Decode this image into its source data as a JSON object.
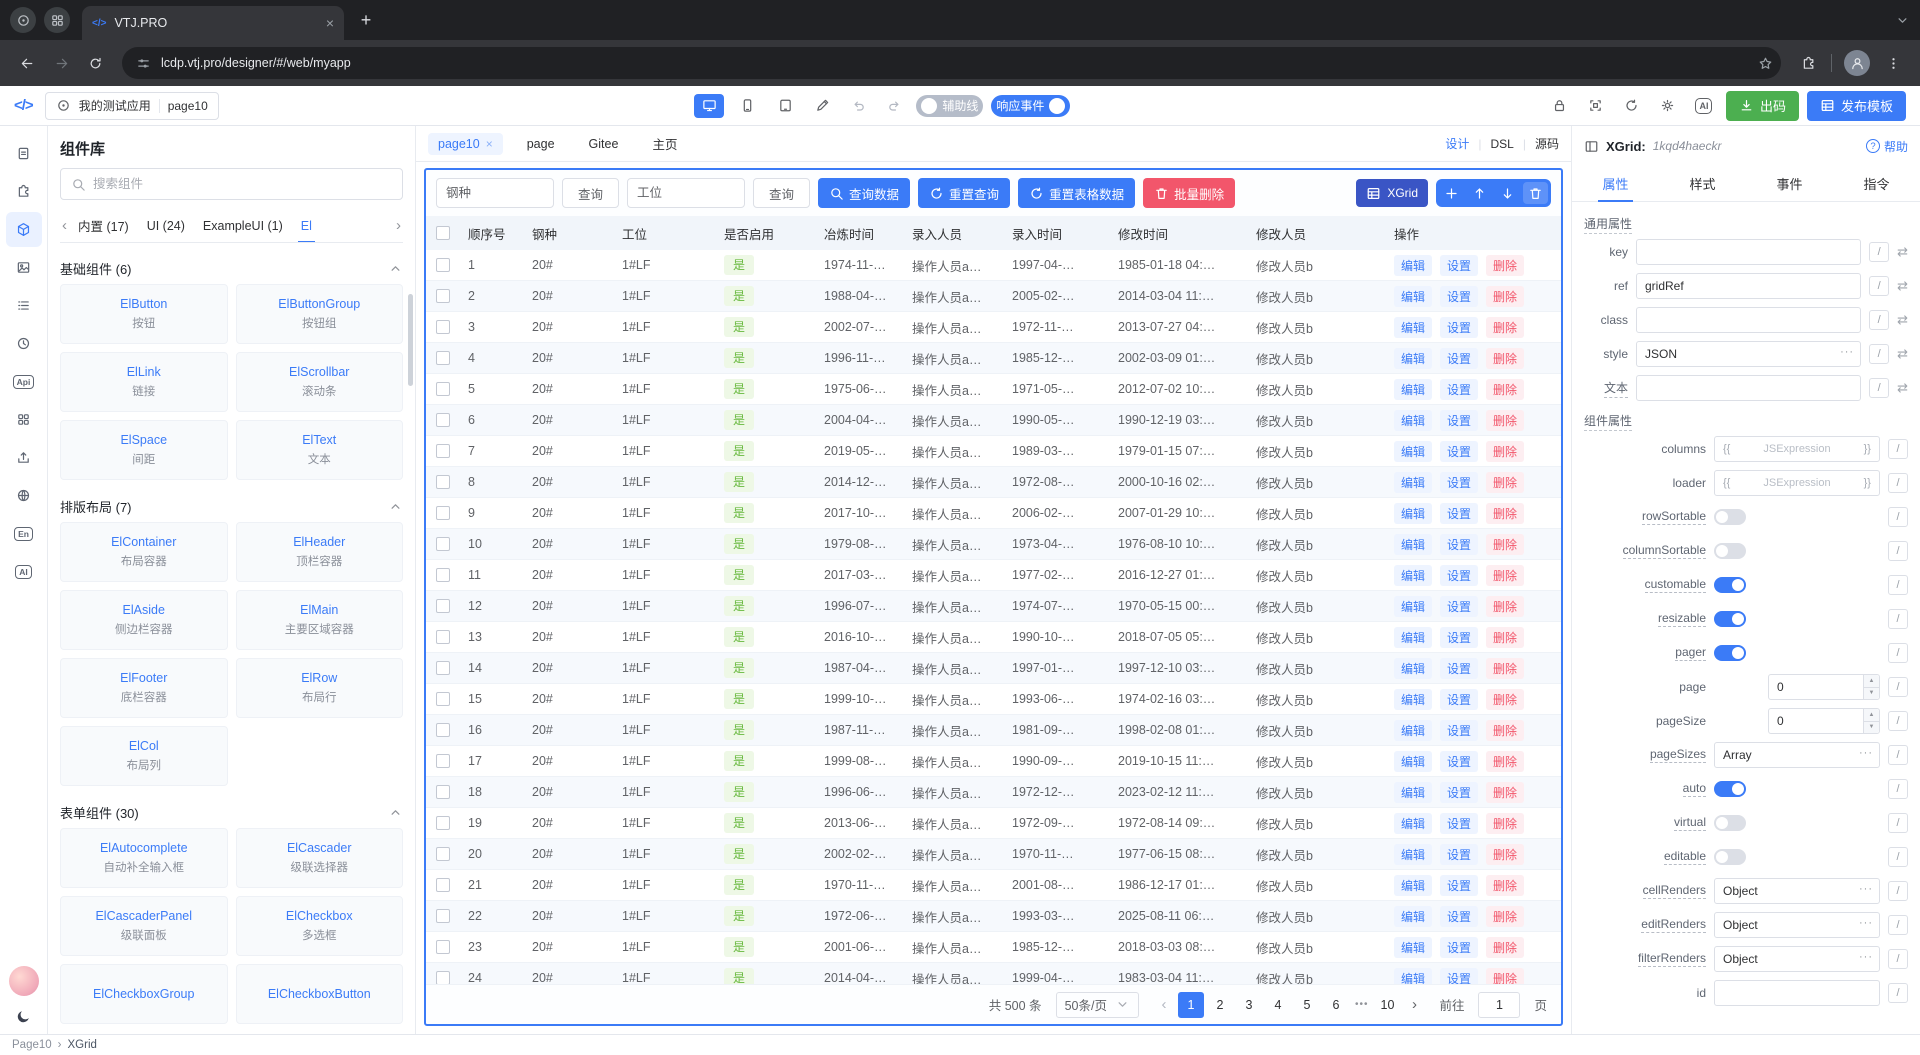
{
  "colors": {
    "accent": "#3b7bf7",
    "green": "#4caf50",
    "red": "#f2566b",
    "navy": "#3a55c5",
    "badge_green": "#67b83d"
  },
  "browser": {
    "tab_title": "VTJ.PRO",
    "url": "lcdp.vtj.pro/designer/#/web/myapp"
  },
  "header": {
    "app_name": "我的测试应用",
    "page_name": "page10",
    "guides_label": "辅助线",
    "events_label": "响应事件",
    "codegen_label": "出码",
    "publish_label": "发布模板"
  },
  "rail": {
    "items": [
      {
        "id": "doc"
      },
      {
        "id": "plugin"
      },
      {
        "id": "cube",
        "active": true
      },
      {
        "id": "frame"
      },
      {
        "id": "outline"
      },
      {
        "id": "history"
      },
      {
        "id": "api",
        "text": "Api"
      },
      {
        "id": "apps"
      },
      {
        "id": "publish"
      },
      {
        "id": "globe"
      },
      {
        "id": "lang",
        "text": "En"
      },
      {
        "id": "ai",
        "text": "AI"
      }
    ]
  },
  "library": {
    "title": "组件库",
    "search_placeholder": "搜索组件",
    "tabs": [
      {
        "label": "内置 (17)"
      },
      {
        "label": "UI (24)"
      },
      {
        "label": "ExampleUI (1)"
      },
      {
        "label": "El",
        "active": true
      }
    ],
    "sections": [
      {
        "title": "基础组件 (6)",
        "items": [
          [
            "ElButton",
            "按钮"
          ],
          [
            "ElButtonGroup",
            "按钮组"
          ],
          [
            "ElLink",
            "链接"
          ],
          [
            "ElScrollbar",
            "滚动条"
          ],
          [
            "ElSpace",
            "间距"
          ],
          [
            "ElText",
            "文本"
          ]
        ]
      },
      {
        "title": "排版布局 (7)",
        "items": [
          [
            "ElContainer",
            "布局容器"
          ],
          [
            "ElHeader",
            "顶栏容器"
          ],
          [
            "ElAside",
            "侧边栏容器"
          ],
          [
            "ElMain",
            "主要区域容器"
          ],
          [
            "ElFooter",
            "底栏容器"
          ],
          [
            "ElRow",
            "布局行"
          ],
          [
            "ElCol",
            "布局列"
          ]
        ]
      },
      {
        "title": "表单组件 (30)",
        "items": [
          [
            "ElAutocomplete",
            "自动补全输入框"
          ],
          [
            "ElCascader",
            "级联选择器"
          ],
          [
            "ElCascaderPanel",
            "级联面板"
          ],
          [
            "ElCheckbox",
            "多选框"
          ],
          [
            "ElCheckboxGroup",
            ""
          ],
          [
            "ElCheckboxButton",
            ""
          ]
        ]
      }
    ]
  },
  "canvas": {
    "tabs": [
      {
        "label": "page10",
        "active": true,
        "closable": true
      },
      {
        "label": "page"
      },
      {
        "label": "Gitee"
      },
      {
        "label": "主页"
      }
    ],
    "modes": [
      {
        "label": "设计",
        "active": true
      },
      {
        "label": "DSL"
      },
      {
        "label": "源码"
      }
    ],
    "toolbar": {
      "steel_placeholder": "钢种",
      "station_placeholder": "工位",
      "search_btn": "查询",
      "query_data": "查询数据",
      "reset_query": "重置查询",
      "reset_table": "重置表格数据",
      "batch_delete": "批量删除",
      "widget_chip": "XGrid"
    },
    "table": {
      "columns": [
        "顺序号",
        "钢种",
        "工位",
        "是否启用",
        "冶炼时间",
        "录入人员",
        "录入时间",
        "修改时间",
        "修改人员",
        "操作"
      ],
      "actions": [
        "编辑",
        "设置",
        "删除"
      ],
      "rows": [
        {
          "n": "1",
          "steel": "20#",
          "station": "1#LF",
          "enabled": "是",
          "smelt": "1974-11-…",
          "entered_by": "操作人员a…",
          "entered_at": "1997-04-…",
          "modified_at": "1985-01-18 04:…",
          "modified_by": "修改人员b"
        },
        {
          "n": "2",
          "steel": "20#",
          "station": "1#LF",
          "enabled": "是",
          "smelt": "1988-04-…",
          "entered_by": "操作人员a…",
          "entered_at": "2005-02-…",
          "modified_at": "2014-03-04 11:…",
          "modified_by": "修改人员b"
        },
        {
          "n": "3",
          "steel": "20#",
          "station": "1#LF",
          "enabled": "是",
          "smelt": "2002-07-…",
          "entered_by": "操作人员a…",
          "entered_at": "1972-11-…",
          "modified_at": "2013-07-27 04:…",
          "modified_by": "修改人员b"
        },
        {
          "n": "4",
          "steel": "20#",
          "station": "1#LF",
          "enabled": "是",
          "smelt": "1996-11-…",
          "entered_by": "操作人员a…",
          "entered_at": "1985-12-…",
          "modified_at": "2002-03-09 01:…",
          "modified_by": "修改人员b"
        },
        {
          "n": "5",
          "steel": "20#",
          "station": "1#LF",
          "enabled": "是",
          "smelt": "1975-06-…",
          "entered_by": "操作人员a…",
          "entered_at": "1971-05-…",
          "modified_at": "2012-07-02 10:…",
          "modified_by": "修改人员b"
        },
        {
          "n": "6",
          "steel": "20#",
          "station": "1#LF",
          "enabled": "是",
          "smelt": "2004-04-…",
          "entered_by": "操作人员a…",
          "entered_at": "1990-05-…",
          "modified_at": "1990-12-19 03:…",
          "modified_by": "修改人员b"
        },
        {
          "n": "7",
          "steel": "20#",
          "station": "1#LF",
          "enabled": "是",
          "smelt": "2019-05-…",
          "entered_by": "操作人员a…",
          "entered_at": "1989-03-…",
          "modified_at": "1979-01-15 07:…",
          "modified_by": "修改人员b"
        },
        {
          "n": "8",
          "steel": "20#",
          "station": "1#LF",
          "enabled": "是",
          "smelt": "2014-12-…",
          "entered_by": "操作人员a…",
          "entered_at": "1972-08-…",
          "modified_at": "2000-10-16 02:…",
          "modified_by": "修改人员b"
        },
        {
          "n": "9",
          "steel": "20#",
          "station": "1#LF",
          "enabled": "是",
          "smelt": "2017-10-…",
          "entered_by": "操作人员a…",
          "entered_at": "2006-02-…",
          "modified_at": "2007-01-29 10:…",
          "modified_by": "修改人员b"
        },
        {
          "n": "10",
          "steel": "20#",
          "station": "1#LF",
          "enabled": "是",
          "smelt": "1979-08-…",
          "entered_by": "操作人员a…",
          "entered_at": "1973-04-…",
          "modified_at": "1976-08-10 10:…",
          "modified_by": "修改人员b"
        },
        {
          "n": "11",
          "steel": "20#",
          "station": "1#LF",
          "enabled": "是",
          "smelt": "2017-03-…",
          "entered_by": "操作人员a…",
          "entered_at": "1977-02-…",
          "modified_at": "2016-12-27 01:…",
          "modified_by": "修改人员b"
        },
        {
          "n": "12",
          "steel": "20#",
          "station": "1#LF",
          "enabled": "是",
          "smelt": "1996-07-…",
          "entered_by": "操作人员a…",
          "entered_at": "1974-07-…",
          "modified_at": "1970-05-15 00:…",
          "modified_by": "修改人员b"
        },
        {
          "n": "13",
          "steel": "20#",
          "station": "1#LF",
          "enabled": "是",
          "smelt": "2016-10-…",
          "entered_by": "操作人员a…",
          "entered_at": "1990-10-…",
          "modified_at": "2018-07-05 05:…",
          "modified_by": "修改人员b"
        },
        {
          "n": "14",
          "steel": "20#",
          "station": "1#LF",
          "enabled": "是",
          "smelt": "1987-04-…",
          "entered_by": "操作人员a…",
          "entered_at": "1997-01-…",
          "modified_at": "1997-12-10 03:…",
          "modified_by": "修改人员b"
        },
        {
          "n": "15",
          "steel": "20#",
          "station": "1#LF",
          "enabled": "是",
          "smelt": "1999-10-…",
          "entered_by": "操作人员a…",
          "entered_at": "1993-06-…",
          "modified_at": "1974-02-16 03:…",
          "modified_by": "修改人员b"
        },
        {
          "n": "16",
          "steel": "20#",
          "station": "1#LF",
          "enabled": "是",
          "smelt": "1987-11-…",
          "entered_by": "操作人员a…",
          "entered_at": "1981-09-…",
          "modified_at": "1998-02-08 01:…",
          "modified_by": "修改人员b"
        },
        {
          "n": "17",
          "steel": "20#",
          "station": "1#LF",
          "enabled": "是",
          "smelt": "1999-08-…",
          "entered_by": "操作人员a…",
          "entered_at": "1990-09-…",
          "modified_at": "2019-10-15 11:…",
          "modified_by": "修改人员b"
        },
        {
          "n": "18",
          "steel": "20#",
          "station": "1#LF",
          "enabled": "是",
          "smelt": "1996-06-…",
          "entered_by": "操作人员a…",
          "entered_at": "1972-12-…",
          "modified_at": "2023-02-12 11:…",
          "modified_by": "修改人员b"
        },
        {
          "n": "19",
          "steel": "20#",
          "station": "1#LF",
          "enabled": "是",
          "smelt": "2013-06-…",
          "entered_by": "操作人员a…",
          "entered_at": "1972-09-…",
          "modified_at": "1972-08-14 09:…",
          "modified_by": "修改人员b"
        },
        {
          "n": "20",
          "steel": "20#",
          "station": "1#LF",
          "enabled": "是",
          "smelt": "2002-02-…",
          "entered_by": "操作人员a…",
          "entered_at": "1970-11-…",
          "modified_at": "1977-06-15 08:…",
          "modified_by": "修改人员b"
        },
        {
          "n": "21",
          "steel": "20#",
          "station": "1#LF",
          "enabled": "是",
          "smelt": "1970-11-…",
          "entered_by": "操作人员a…",
          "entered_at": "2001-08-…",
          "modified_at": "1986-12-17 01:…",
          "modified_by": "修改人员b"
        },
        {
          "n": "22",
          "steel": "20#",
          "station": "1#LF",
          "enabled": "是",
          "smelt": "1972-06-…",
          "entered_by": "操作人员a…",
          "entered_at": "1993-03-…",
          "modified_at": "2025-08-11 06:…",
          "modified_by": "修改人员b"
        },
        {
          "n": "23",
          "steel": "20#",
          "station": "1#LF",
          "enabled": "是",
          "smelt": "2001-06-…",
          "entered_by": "操作人员a…",
          "entered_at": "1985-12-…",
          "modified_at": "2018-03-03 08:…",
          "modified_by": "修改人员b"
        },
        {
          "n": "24",
          "steel": "20#",
          "station": "1#LF",
          "enabled": "是",
          "smelt": "2014-04-…",
          "entered_by": "操作人员a…",
          "entered_at": "1999-04-…",
          "modified_at": "1983-03-04 11:…",
          "modified_by": "修改人员b"
        }
      ]
    },
    "pager": {
      "total": "共 500 条",
      "page_size": "50条/页",
      "pages": [
        "1",
        "2",
        "3",
        "4",
        "5",
        "6"
      ],
      "active_page": "1",
      "ellipsis": "•••",
      "last": "10",
      "goto_label": "前往",
      "goto_value": "1",
      "goto_suffix": "页"
    }
  },
  "inspector": {
    "widget": "XGrid:",
    "instance": "1kqd4haeckr",
    "help": "帮助",
    "expr_open": "{{",
    "expr_close": "}}",
    "tabs": [
      {
        "label": "属性",
        "active": true
      },
      {
        "label": "样式"
      },
      {
        "label": "事件"
      },
      {
        "label": "指令"
      }
    ],
    "sections": [
      {
        "title": "通用属性",
        "label_width": 44,
        "swap": true,
        "fields": [
          {
            "label": "key",
            "type": "input",
            "value": ""
          },
          {
            "label": "ref",
            "type": "input",
            "value": "gridRef"
          },
          {
            "label": "class",
            "type": "input",
            "value": ""
          },
          {
            "label": "style",
            "type": "ellipsis",
            "value": "JSON"
          },
          {
            "label": "文本",
            "type": "input",
            "value": "",
            "underline": true
          }
        ]
      },
      {
        "title": "组件属性",
        "label_width": 122,
        "swap": false,
        "fields": [
          {
            "label": "columns",
            "type": "expr",
            "value": "JSExpression"
          },
          {
            "label": "loader",
            "type": "expr",
            "value": "JSExpression"
          },
          {
            "label": "rowSortable",
            "type": "switch",
            "value": false,
            "underline": true
          },
          {
            "label": "columnSortable",
            "type": "switch",
            "value": false,
            "underline": true
          },
          {
            "label": "customable",
            "type": "switch",
            "value": true,
            "underline": true
          },
          {
            "label": "resizable",
            "type": "switch",
            "value": true,
            "underline": true
          },
          {
            "label": "pager",
            "type": "switch",
            "value": true,
            "underline": true
          },
          {
            "label": "page",
            "type": "number",
            "value": "0"
          },
          {
            "label": "pageSize",
            "type": "number",
            "value": "0"
          },
          {
            "label": "pageSizes",
            "type": "ellipsis",
            "value": "Array",
            "underline": true
          },
          {
            "label": "auto",
            "type": "switch",
            "value": true,
            "underline": true
          },
          {
            "label": "virtual",
            "type": "switch",
            "value": false,
            "underline": true
          },
          {
            "label": "editable",
            "type": "switch",
            "value": false,
            "underline": true
          },
          {
            "label": "cellRenders",
            "type": "ellipsis",
            "value": "Object",
            "underline": true
          },
          {
            "label": "editRenders",
            "type": "ellipsis",
            "value": "Object",
            "underline": true
          },
          {
            "label": "filterRenders",
            "type": "ellipsis",
            "value": "Object",
            "underline": true
          },
          {
            "label": "id",
            "type": "input",
            "value": ""
          }
        ]
      }
    ]
  },
  "statusbar": {
    "page": "Page10",
    "sep": "›",
    "widget": "XGrid"
  }
}
